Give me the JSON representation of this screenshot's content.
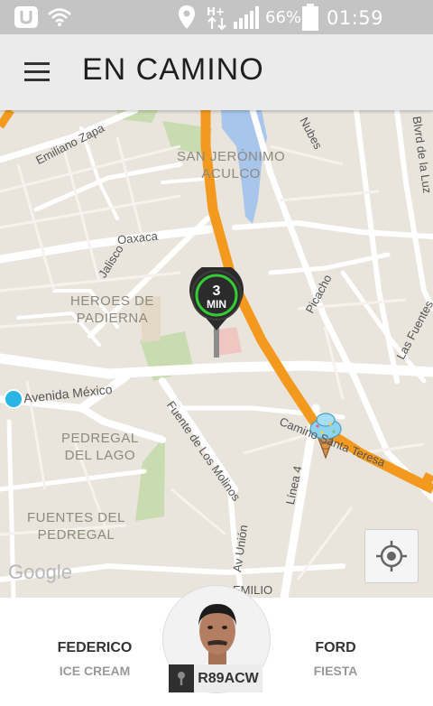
{
  "status_bar": {
    "battery_percent": "66%",
    "time": "01:59 p.m."
  },
  "header": {
    "title": "EN CAMINO"
  },
  "map": {
    "eta": {
      "value": "3",
      "unit": "MIN"
    },
    "street_labels": {
      "emiliano_zapata": "Emiliano Zapa",
      "oaxaca": "Oaxaca",
      "jalisco": "Jalisco",
      "nubes": "Nubes",
      "picacho": "Picacho",
      "blvd_de_la_luz": "Blvrd de la Luz",
      "las_fuentes": "Las Fuentes",
      "avenida_mexico": "Avenida México",
      "fuente_de_los_molinos": "Fuente de Los Molinos",
      "camino_santa_teresa": "Camino Santa Teresa",
      "linea_4": "Línea 4",
      "av_union": "Av Unión",
      "emilio": "EMILIO"
    },
    "area_labels": {
      "san_jeronimo_1": "SAN JERÓNIMO",
      "san_jeronimo_2": "ACULCO",
      "heroes_1": "HEROES DE",
      "heroes_2": "PADIERNA",
      "pedregal_lago_1": "PEDREGAL",
      "pedregal_lago_2": "DEL LAGO",
      "fuentes_pedregal_1": "FUENTES DEL",
      "fuentes_pedregal_2": "PEDREGAL"
    },
    "attribution": "Google",
    "route_color": "#f39a1e",
    "marker_color": "#29b6e6"
  },
  "driver": {
    "name": "FEDERICO",
    "subtitle": "ICE CREAM",
    "plate": "R89ACW"
  },
  "vehicle": {
    "make": "FORD",
    "model": "FIESTA"
  }
}
